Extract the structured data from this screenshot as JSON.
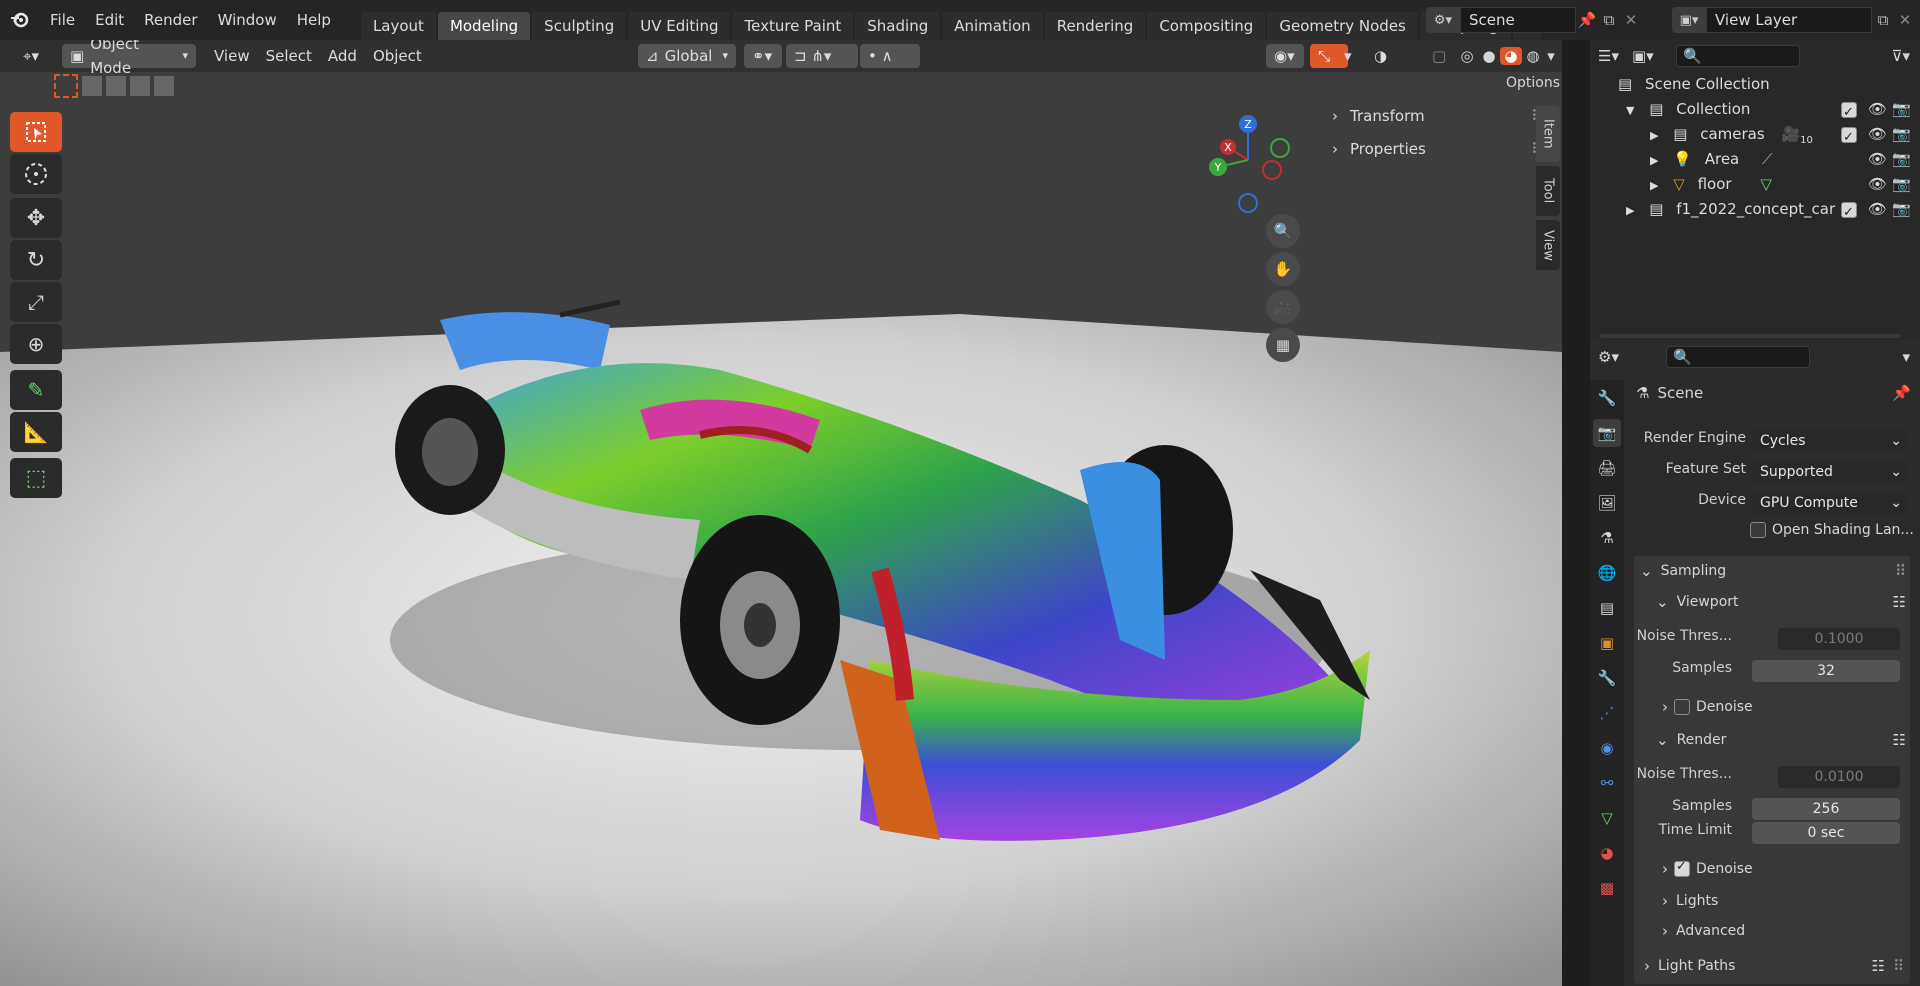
{
  "top_menu": {
    "items": [
      "File",
      "Edit",
      "Render",
      "Window",
      "Help"
    ]
  },
  "workspaces": {
    "tabs": [
      "Layout",
      "Modeling",
      "Sculpting",
      "UV Editing",
      "Texture Paint",
      "Shading",
      "Animation",
      "Rendering",
      "Compositing",
      "Geometry Nodes",
      "Scripting"
    ],
    "active": "Modeling"
  },
  "scene": {
    "name": "Scene",
    "view_layer": "View Layer"
  },
  "viewport_header": {
    "mode": "Object Mode",
    "menus": [
      "View",
      "Select",
      "Add",
      "Object"
    ],
    "orientation": "Global",
    "options_label": "Options"
  },
  "gizmo": {
    "z": "Z",
    "x": "X",
    "y": "Y"
  },
  "npanel": {
    "panels": [
      "Transform",
      "Properties"
    ],
    "tabs": [
      "Item",
      "Tool",
      "View"
    ]
  },
  "outliner": {
    "root": "Scene Collection",
    "rows": [
      {
        "name": "Collection"
      },
      {
        "name": "cameras",
        "badge": "10"
      },
      {
        "name": "Area"
      },
      {
        "name": "floor"
      },
      {
        "name": "f1_2022_concept_car"
      }
    ]
  },
  "properties": {
    "context": "Scene",
    "render_engine": {
      "label": "Render Engine",
      "value": "Cycles"
    },
    "feature_set": {
      "label": "Feature Set",
      "value": "Supported"
    },
    "device": {
      "label": "Device",
      "value": "GPU Compute"
    },
    "osl": {
      "label": "Open Shading Lan..."
    },
    "sampling": {
      "label": "Sampling",
      "viewport": {
        "label": "Viewport",
        "noise_label": "Noise Thres...",
        "noise_value": "0.1000",
        "samples_label": "Samples",
        "samples_value": "32",
        "denoise_label": "Denoise"
      },
      "render": {
        "label": "Render",
        "noise_label": "Noise Thres...",
        "noise_value": "0.0100",
        "samples_label": "Samples",
        "samples_value": "256",
        "time_limit_label": "Time Limit",
        "time_limit_value": "0 sec",
        "denoise_label": "Denoise"
      },
      "lights_label": "Lights",
      "advanced_label": "Advanced"
    },
    "light_paths_label": "Light Paths"
  },
  "colors": {
    "accent": "#4772b3",
    "active_tool": "#e0582a",
    "viewport_bg": "#3d3d3d"
  }
}
